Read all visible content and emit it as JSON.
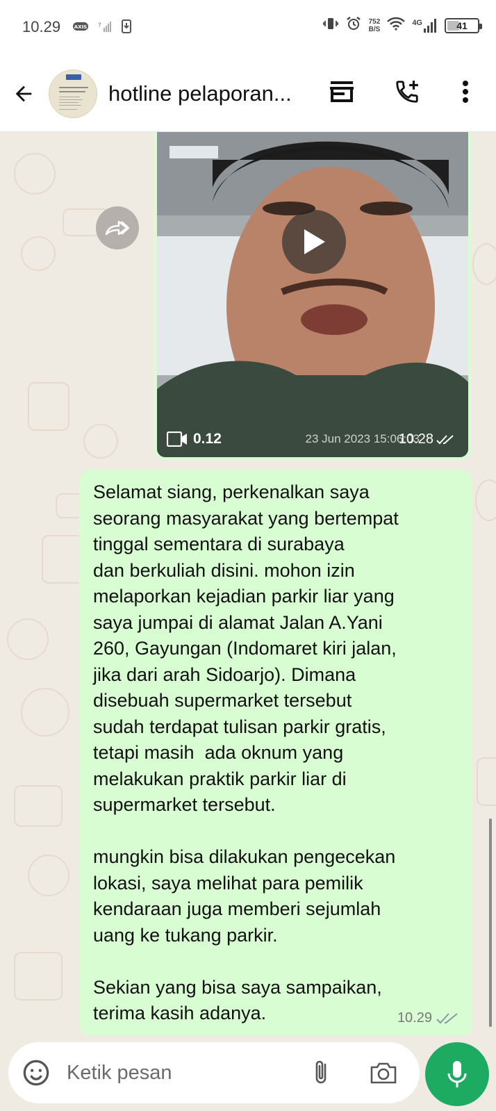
{
  "status_bar": {
    "time": "10.29",
    "net_speed_value": "752",
    "net_speed_unit": "B/S",
    "network_type": "4G",
    "battery_level": "41"
  },
  "header": {
    "chat_title": "hotline pelaporan..."
  },
  "video_message": {
    "duration": "0.12",
    "date_stamp": "23 Jun 2023 15:06:03",
    "sent_time": "10.28"
  },
  "text_message": {
    "body": "Selamat siang, perkenalkan saya\nseorang masyarakat yang bertempat\ntinggal sementara di surabaya\ndan berkuliah disini. mohon izin\nmelaporkan kejadian parkir liar yang\nsaya jumpai di alamat Jalan A.Yani\n260, Gayungan (Indomaret kiri jalan,\njika dari arah Sidoarjo). Dimana\ndisebuah supermarket tersebut\nsudah terdapat tulisan parkir gratis,\ntetapi masih  ada oknum yang\nmelakukan praktik parkir liar di\nsupermarket tersebut.\n\nmungkin bisa dilakukan pengecekan\nlokasi, saya melihat para pemilik\nkendaraan juga memberi sejumlah\nuang ke tukang parkir.\n\nSekian yang bisa saya sampaikan,\nterima kasih adanya.",
    "sent_time": "10.29"
  },
  "input": {
    "placeholder": "Ketik pesan"
  },
  "colors": {
    "bubble_outgoing": "#d9fdd3",
    "chat_background": "#efeae2",
    "mic_button": "#1daa61",
    "read_ticks": "#8a96a3"
  },
  "icons": {
    "back": "arrow-left-icon",
    "shop": "store-icon",
    "call": "add-call-icon",
    "menu": "more-vert-icon",
    "forward": "forward-icon",
    "play": "play-icon",
    "video": "videocam-icon",
    "emoji": "emoji-icon",
    "attach": "paperclip-icon",
    "camera": "camera-icon",
    "mic": "mic-icon"
  }
}
